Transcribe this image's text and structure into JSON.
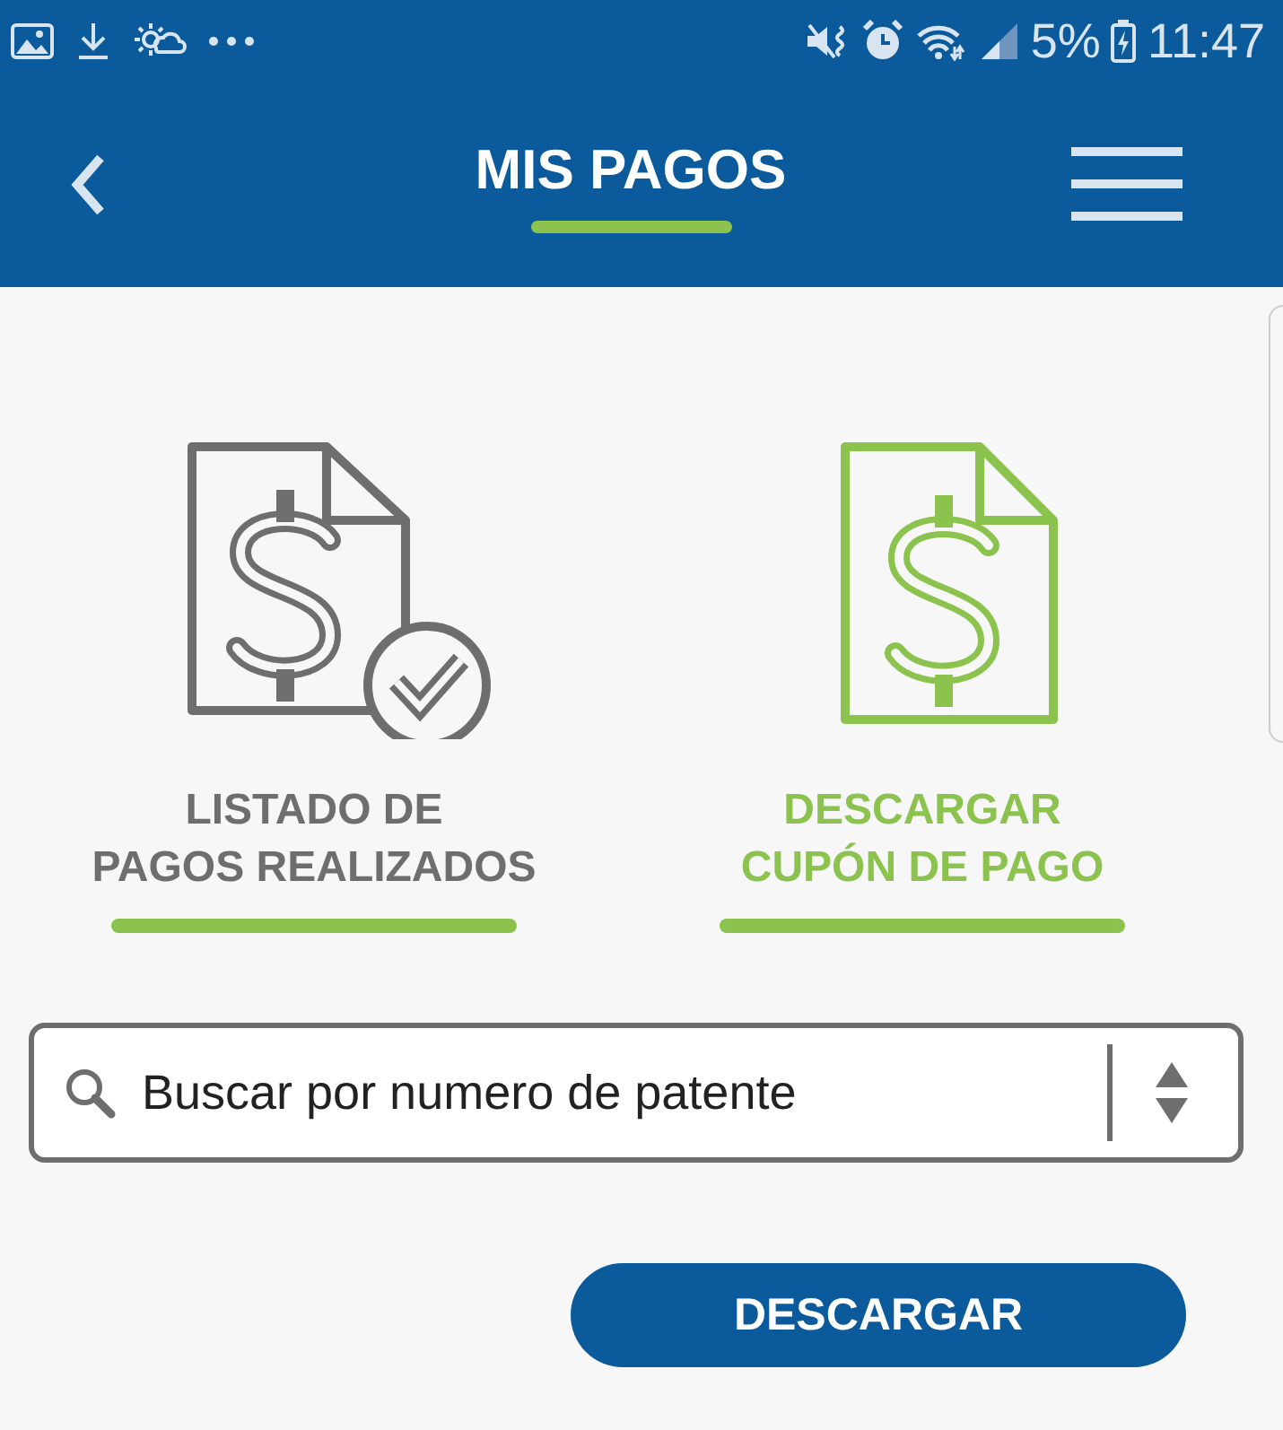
{
  "status_bar": {
    "battery": "5%",
    "time": "11:47"
  },
  "header": {
    "title": "MIS PAGOS"
  },
  "options": [
    {
      "kind": "list",
      "label_lines": [
        "LISTADO DE",
        "PAGOS REALIZADOS"
      ],
      "selected": false
    },
    {
      "kind": "download",
      "label_lines": [
        "DESCARGAR",
        "CUPÓN DE PAGO"
      ],
      "selected": true
    }
  ],
  "search": {
    "placeholder": "Buscar por numero de patente"
  },
  "buttons": [
    "DESCARGAR"
  ]
}
